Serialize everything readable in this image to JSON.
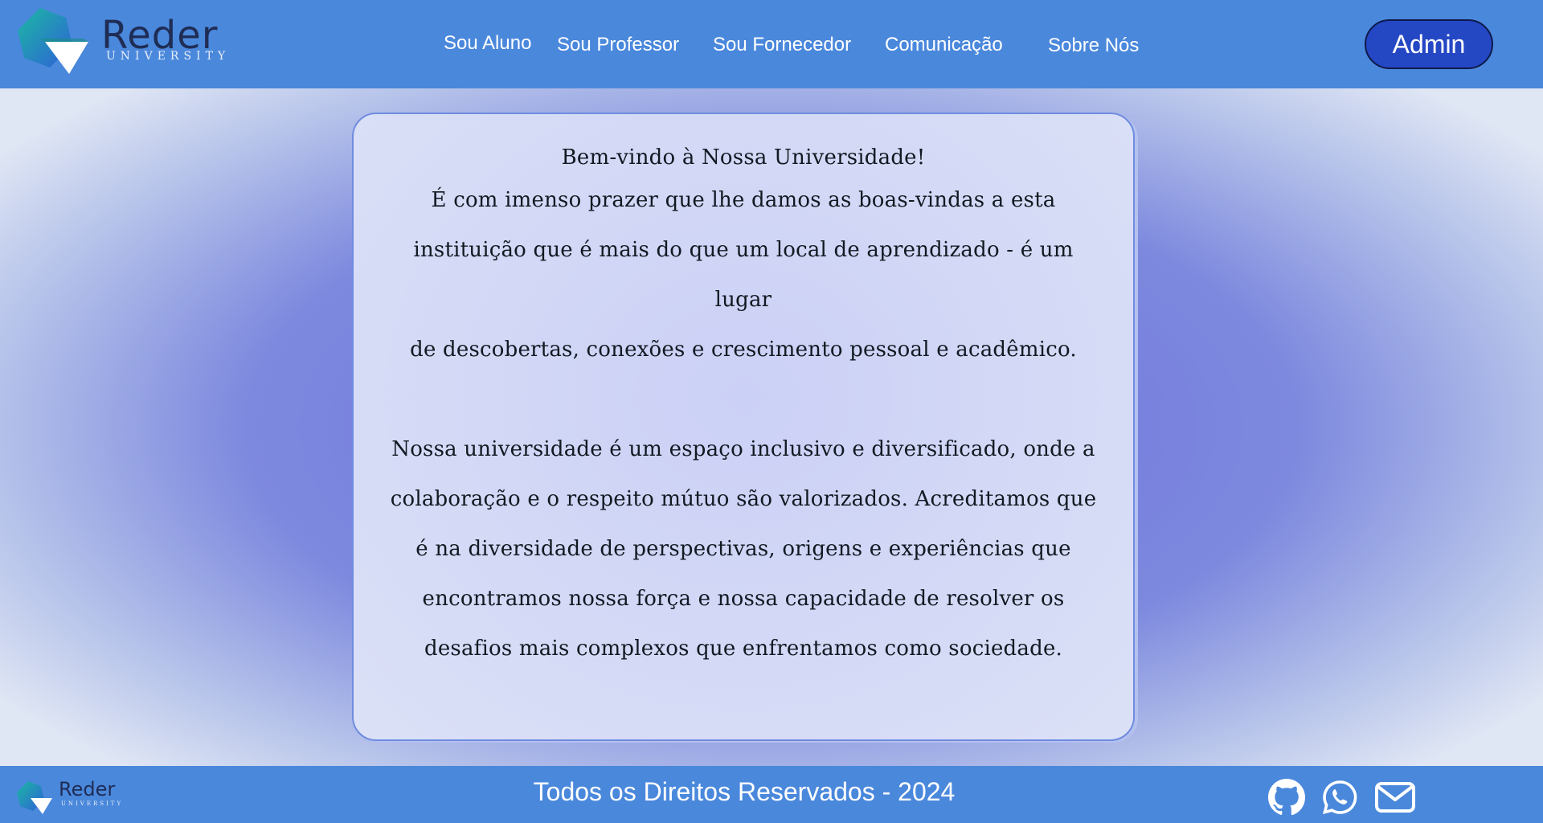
{
  "header": {
    "logo": {
      "word": "Reder",
      "subtitle": "UNIVERSITY"
    },
    "nav": [
      {
        "label": "Sou Aluno"
      },
      {
        "label": "Sou Professor"
      },
      {
        "label": "Sou Fornecedor"
      },
      {
        "label": "Comunicação"
      },
      {
        "label": "Sobre Nós"
      }
    ],
    "admin_label": "Admin"
  },
  "main": {
    "welcome_title": "Bem-vindo à Nossa Universidade!",
    "paragraph1_lines": [
      "É com imenso prazer que lhe damos as boas-vindas a esta",
      "instituição que é mais do que um local de aprendizado - é um lugar",
      "de descobertas, conexões e crescimento pessoal e acadêmico."
    ],
    "paragraph2_lines": [
      "Nossa universidade é um espaço inclusivo e diversificado, onde a",
      "colaboração e o respeito mútuo são valorizados. Acreditamos que",
      "é na diversidade de perspectivas, origens e experiências que",
      "encontramos nossa força e nossa capacidade de resolver os",
      "desafios mais complexos que enfrentamos como sociedade."
    ]
  },
  "footer": {
    "logo": {
      "word": "Reder",
      "subtitle": "UNIVERSITY"
    },
    "copyright": "Todos os Direitos Reservados - 2024",
    "social_icons": [
      "github-icon",
      "whatsapp-icon",
      "mail-icon"
    ]
  },
  "colors": {
    "header_bg": "#4a88dc",
    "admin_button_bg": "#2447c4",
    "background_center": "#6e72e0",
    "card_bg": "#dbe1f6",
    "logo_teal": "#1fb3a6",
    "logo_blue": "#2f6fd8"
  }
}
